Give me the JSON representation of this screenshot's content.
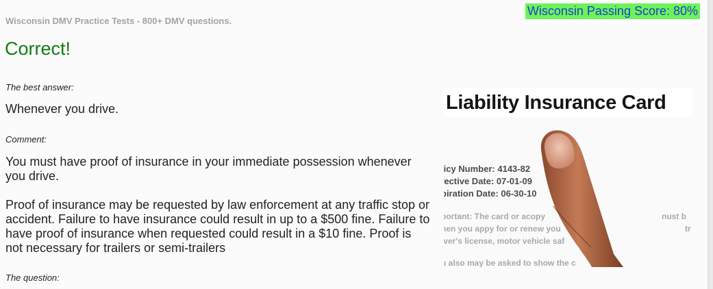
{
  "header": {
    "passing_score": "Wisconsin Passing Score: 80%",
    "site_title": "Wisconsin DMV Practice Tests - 800+ DMV questions."
  },
  "result": {
    "heading": "Correct!"
  },
  "answer": {
    "label": "The best answer:",
    "text": "Whenever you drive."
  },
  "comment": {
    "label": "Comment:",
    "paragraph_1": "You must have proof of insurance in your immediate possession whenever you drive.",
    "paragraph_2": "Proof of insurance may be requested by law enforcement at any traffic stop or accident. Failure to have insurance could result in up to a $500 fine. Failure to have proof of insurance when requested could result in a $10 fine. Proof is not necessary for trailers or semi-trailers"
  },
  "question": {
    "label": "The question:"
  },
  "illustration": {
    "title": "Liability Insurance Card",
    "lines": [
      "licy Number: 4143-82",
      "fective Date: 07-01-09",
      "piration Date: 06-30-10",
      "portant: The card or acopy",
      "nust b",
      "nen you appy for or renew you",
      "tr",
      "iver's license, motor vehicle saf",
      "u also may be asked to show the c"
    ]
  },
  "colors": {
    "passing_score_bg": "#6df35a",
    "passing_score_text": "#1d3fcc",
    "correct_green": "#137a13"
  }
}
